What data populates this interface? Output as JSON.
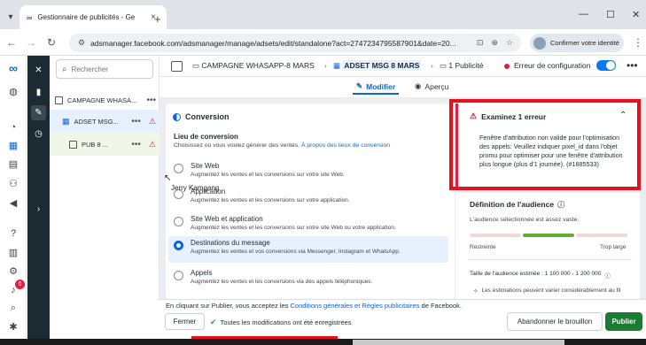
{
  "browser": {
    "tab_title": "Gestionnaire de publicités - Ge",
    "url": "adsmanager.facebook.com/adsmanager/manage/adsets/edit/standalone?act=2747234795587901&date=20...",
    "confirm_identity": "Confirmer votre identité"
  },
  "tree": {
    "search_placeholder": "Rechercher",
    "campaign": "CAMPAGNE WHASA...",
    "adset": "ADSET MSG...",
    "ad": "PUB 8 ..."
  },
  "breadcrumb": {
    "campaign": "CAMPAGNE WHASAPP-8 MARS",
    "adset": "ADSET MSG 8 MARS",
    "ads": "1 Publicité",
    "status": "Erreur de configuration"
  },
  "editbar": {
    "edit": "Modifier",
    "preview": "Aperçu"
  },
  "conversion": {
    "title": "Conversion",
    "location_title": "Lieu de conversion",
    "location_desc": "Choisissez où vous voulez générer des ventes.",
    "location_link": "À propos des lieux de conversion",
    "options": [
      {
        "label": "Site Web",
        "desc": "Augmentez les ventes et les conversions sur votre site Web.",
        "selected": false
      },
      {
        "label": "Application",
        "desc": "Augmentez les ventes et les conversions sur votre application.",
        "selected": false
      },
      {
        "label": "Site Web et application",
        "desc": "Augmentez les ventes et les conversions sur votre site Web ou votre application.",
        "selected": false
      },
      {
        "label": "Destinations du message",
        "desc": "Augmentez les ventes et vos conversions via Messenger, Instagram et WhatsApp.",
        "selected": true
      },
      {
        "label": "Appels",
        "desc": "Augmentez les ventes et les conversions via des appels téléphoniques.",
        "selected": false
      }
    ],
    "overlay_name": "Jerry Kamgang"
  },
  "error": {
    "title": "Examinez 1 erreur",
    "body": "Fenêtre d'attribution non valide pour l'optimisation des appels: Veuillez indiquer pixel_id dans l'objet promu pour optimiser pour une fenêtre d'attribution plus longue (plus d'1 journée). (#1885533)"
  },
  "audience": {
    "title": "Définition de l'audience",
    "subtitle": "L'audience sélectionnée est assez vaste.",
    "min_label": "Restreinte",
    "max_label": "Trop large",
    "size": "Taille de l'audience estimée : 1 100 000 - 1 200 000",
    "note": "Les estimations peuvent varier considérablement au fil"
  },
  "footer": {
    "text_prefix": "En cliquant sur Publier, vous acceptez les",
    "terms_link": "Conditions générales et Règles publicitaires",
    "text_suffix": "de Facebook.",
    "close": "Fermer",
    "saved": "Toutes les modifications ont été enregistrées",
    "discard": "Abandonner le brouillon",
    "publish": "Publier"
  },
  "notifications_count": "6",
  "colors": {
    "accent": "#0a66d8",
    "error": "#e41e3f",
    "publish": "#1a7c32"
  }
}
